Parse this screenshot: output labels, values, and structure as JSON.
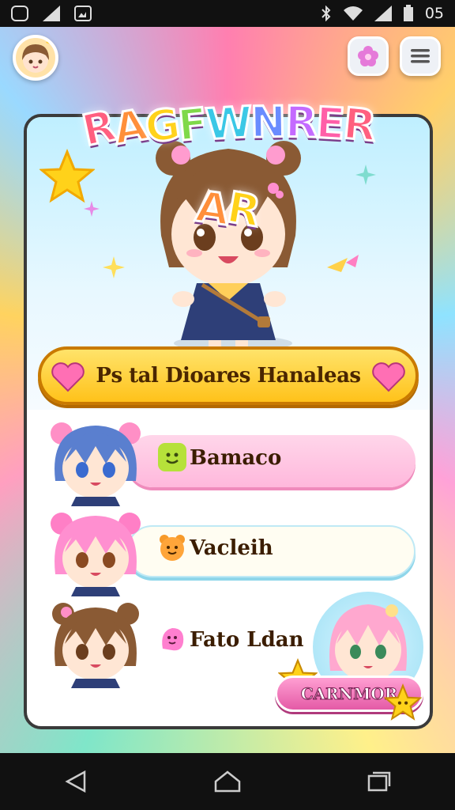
{
  "status_bar": {
    "time": "05",
    "icons": [
      "game-controller-icon",
      "signal-chart-icon",
      "photo-icon",
      "bluetooth-icon",
      "wifi-icon",
      "cell-signal-icon",
      "battery-icon"
    ]
  },
  "header": {
    "logo_text": "RAGFWNRERAR",
    "avatar_icon": "girl-avatar-icon",
    "gift_icon": "flower-icon",
    "menu_icon": "hamburger-menu-icon"
  },
  "banner": {
    "text": "Ps tal Dioares Hanaleas"
  },
  "list": {
    "items": [
      {
        "label": "Bamaco",
        "icon": "smile-square-icon",
        "icon_color": "#b6e13a",
        "style": "pink"
      },
      {
        "label": "Vacleih",
        "icon": "bear-face-icon",
        "icon_color": "#ffa53a",
        "style": "white"
      },
      {
        "label": "Fato Ldan",
        "icon": "pink-blob-icon",
        "icon_color": "#ff7fcf",
        "style": "none"
      }
    ]
  },
  "corner_button": {
    "label": "CARNMOR"
  },
  "colors": {
    "accent_pink": "#ff5fa8",
    "banner_yellow": "#ffc21a",
    "card_border": "#3a3a3a"
  }
}
